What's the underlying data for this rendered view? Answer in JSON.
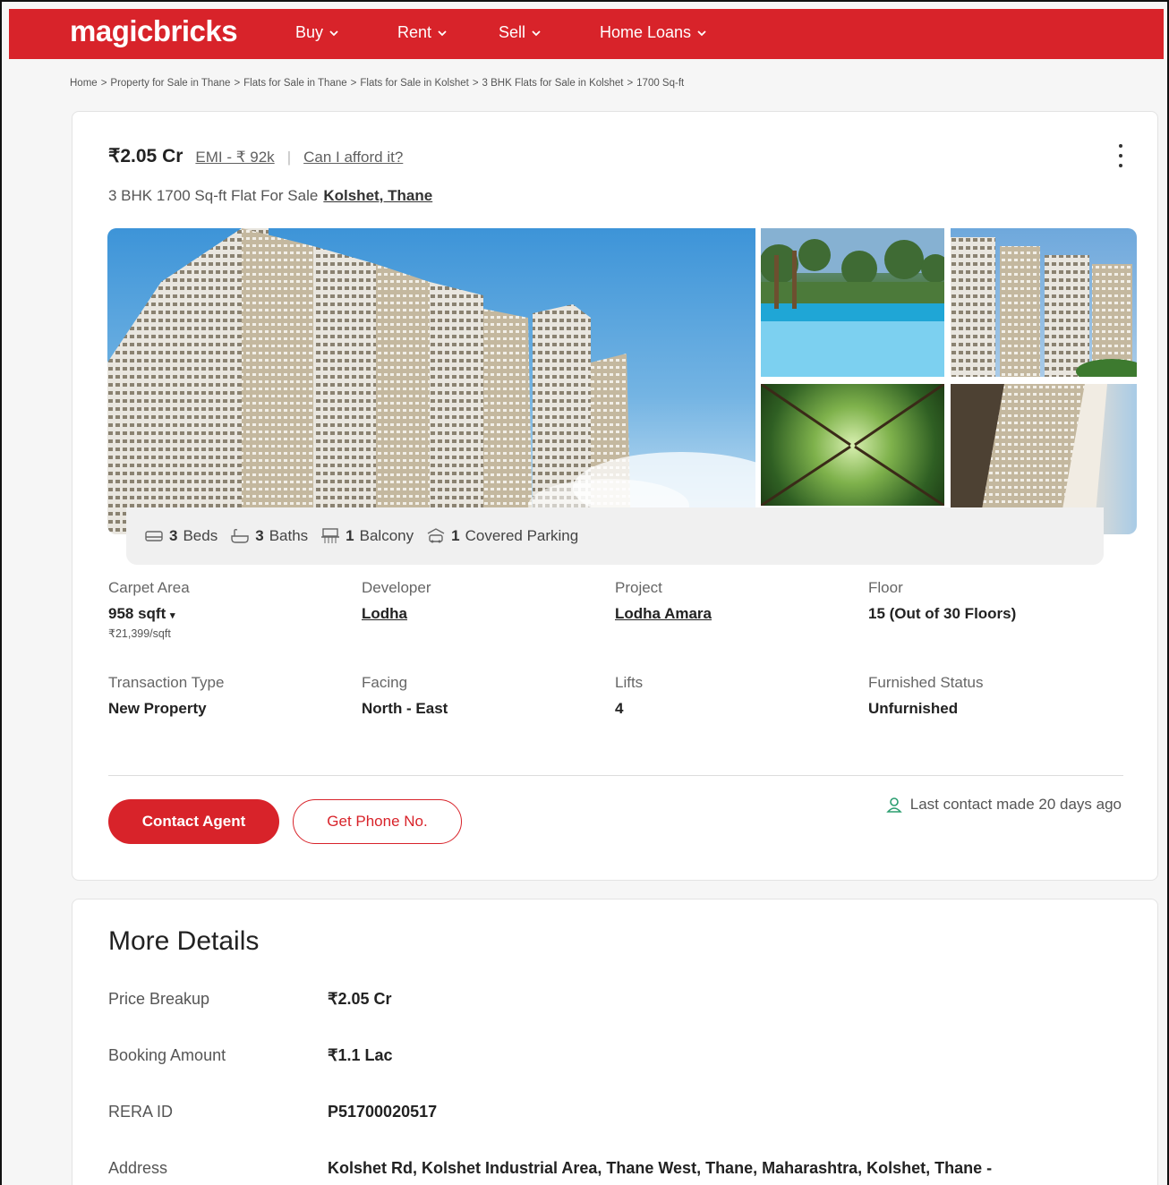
{
  "header": {
    "logo": "magicbricks",
    "nav": [
      {
        "label": "Buy"
      },
      {
        "label": "Rent"
      },
      {
        "label": "Sell"
      },
      {
        "label": "Home Loans"
      }
    ]
  },
  "breadcrumb": [
    "Home",
    "Property for Sale in Thane",
    "Flats for Sale in Thane",
    "Flats for Sale in Kolshet",
    "3 BHK Flats for Sale in Kolshet",
    "1700 Sq-ft"
  ],
  "breadcrumb_sep": ">",
  "listing": {
    "price": "₹2.05 Cr",
    "emi": "EMI - ₹ 92k",
    "afford": "Can I afford it?",
    "title": "3 BHK 1700 Sq-ft Flat For Sale",
    "location": "Kolshet, Thane",
    "amenities": {
      "beds_n": "3",
      "beds": "Beds",
      "baths_n": "3",
      "baths": "Baths",
      "balcony_n": "1",
      "balcony": "Balcony",
      "parking_n": "1",
      "parking": "Covered Parking"
    },
    "details": {
      "carpet_area": {
        "label": "Carpet Area",
        "value": "958 sqft",
        "sub": "₹21,399/sqft"
      },
      "developer": {
        "label": "Developer",
        "value": "Lodha"
      },
      "project": {
        "label": "Project",
        "value": "Lodha Amara"
      },
      "floor": {
        "label": "Floor",
        "value": "15 (Out of 30 Floors)"
      },
      "transaction": {
        "label": "Transaction Type",
        "value": "New Property"
      },
      "facing": {
        "label": "Facing",
        "value": "North - East"
      },
      "lifts": {
        "label": "Lifts",
        "value": "4"
      },
      "furnished": {
        "label": "Furnished Status",
        "value": "Unfurnished"
      }
    },
    "contact_agent": "Contact Agent",
    "get_phone": "Get Phone No.",
    "last_contact": "Last contact made 20 days ago"
  },
  "more_details": {
    "title": "More Details",
    "rows": [
      {
        "k": "Price Breakup",
        "v": "₹2.05 Cr"
      },
      {
        "k": "Booking Amount",
        "v": "₹1.1 Lac"
      },
      {
        "k": "RERA ID",
        "v": "P51700020517"
      },
      {
        "k": "Address",
        "v": "Kolshet Rd, Kolshet Industrial Area, Thane West, Thane, Maharashtra, Kolshet, Thane -"
      }
    ]
  },
  "colors": {
    "brand": "#d8232a",
    "accent_green": "#2a9d6f"
  },
  "icons": [
    "chevron-down-icon",
    "kebab-menu-icon",
    "bed-icon",
    "bath-icon",
    "balcony-icon",
    "car-icon",
    "user-icon"
  ]
}
